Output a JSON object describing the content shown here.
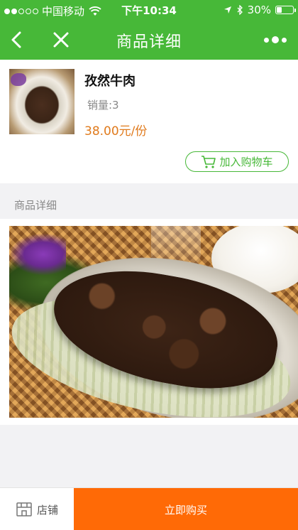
{
  "status_bar": {
    "carrier": "中国移动",
    "time": "下午10:34",
    "battery": "30%",
    "battery_level": 0.3,
    "icons": [
      "signal-icon",
      "wifi-icon",
      "location-icon",
      "bluetooth-icon",
      "battery-icon"
    ]
  },
  "navbar": {
    "title": "商品详细",
    "icons": [
      "back-icon",
      "close-icon",
      "more-icon"
    ]
  },
  "product": {
    "name": "孜然牛肉",
    "sales": "销量:3",
    "price": "38.00元/份",
    "add_to_cart": "加入购物车"
  },
  "detail": {
    "section_title": "商品详细"
  },
  "bottom_bar": {
    "shop_label": "店铺",
    "buy_now": "立即购买"
  },
  "colors": {
    "primary_green": "#47b838",
    "price_orange": "#e07a1c",
    "buy_orange": "#ff6a06",
    "background": "#f2f2f4"
  }
}
